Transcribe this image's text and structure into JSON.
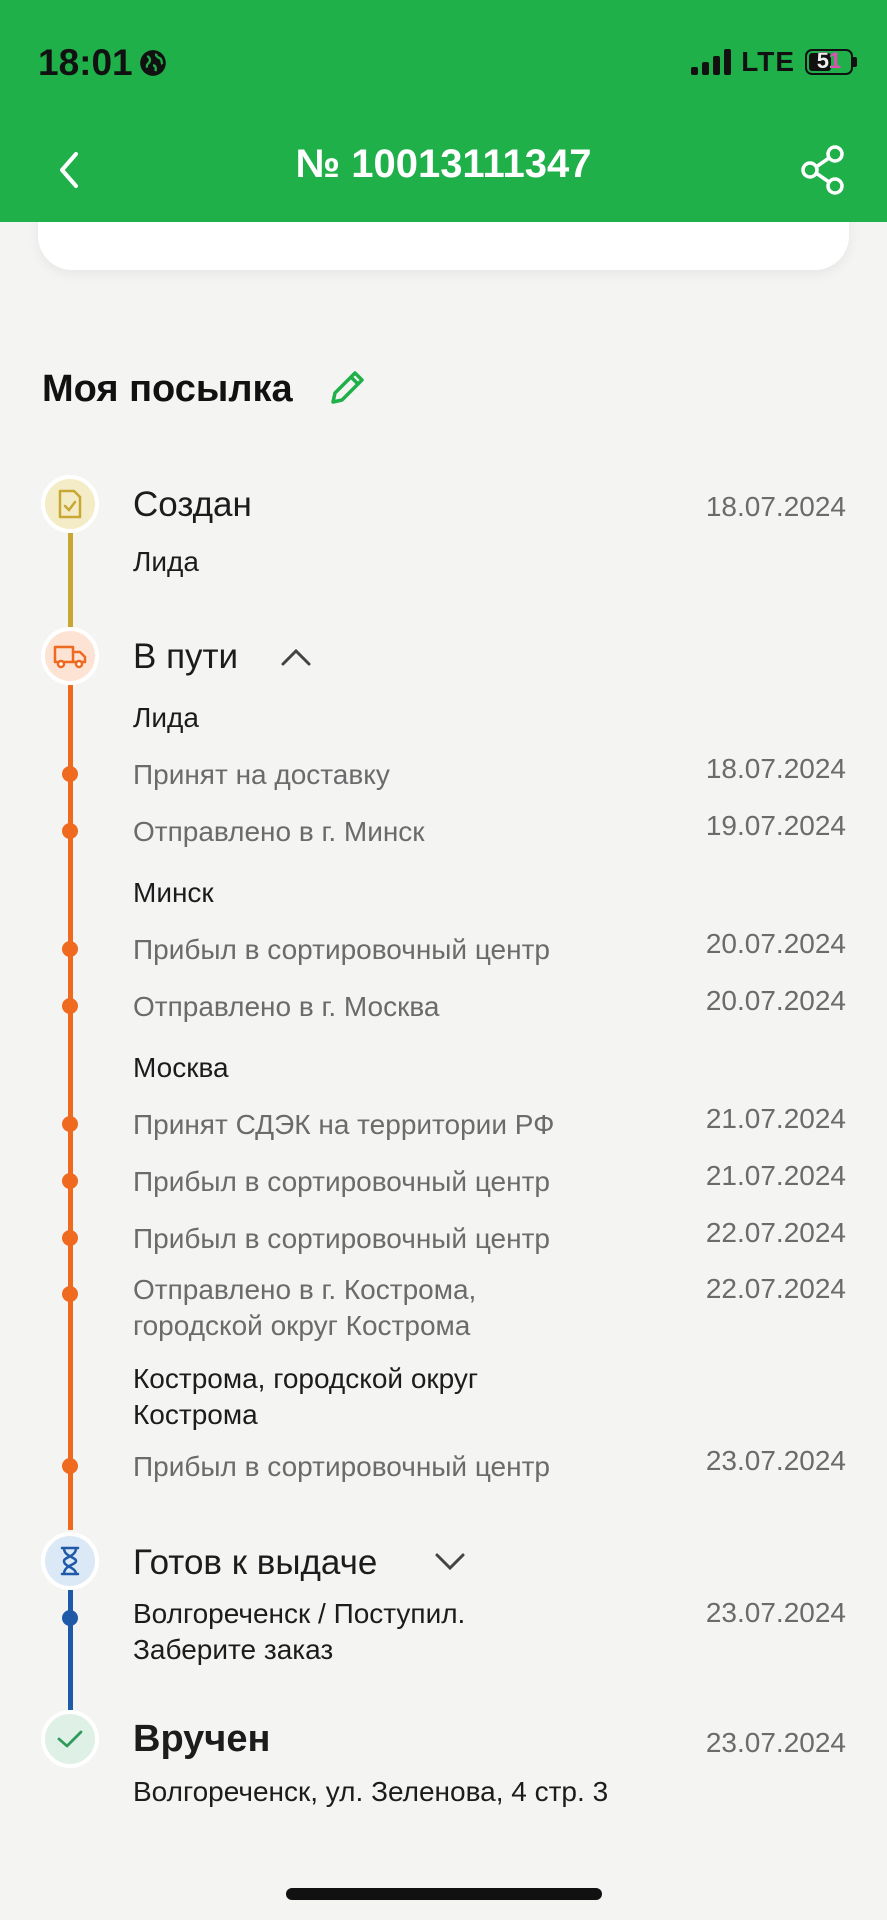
{
  "status_bar": {
    "time": "18:01",
    "network": "LTE",
    "battery": "51"
  },
  "header": {
    "title": "№ 10013111347"
  },
  "section": {
    "title": "Моя посылка"
  },
  "colors": {
    "brand_green": "#1fb04a",
    "created": "#c8a733",
    "transit": "#ef6a1f",
    "ready": "#1e5aa8",
    "delivered": "#2f9b5b"
  },
  "stages": {
    "created": {
      "name": "Создан",
      "date": "18.07.2024",
      "city": "Лида",
      "icon": "document-check-icon"
    },
    "transit": {
      "name": "В пути",
      "icon": "truck-icon",
      "cities": [
        "Лида",
        "Минск",
        "Москва",
        "Кострома, городской округ Кострома"
      ],
      "events": [
        {
          "label": "Принят на доставку",
          "date": "18.07.2024"
        },
        {
          "label": "Отправлено в г. Минск",
          "date": "19.07.2024"
        },
        {
          "label": "Прибыл в сортировочный центр",
          "date": "20.07.2024"
        },
        {
          "label": "Отправлено в г. Москва",
          "date": "20.07.2024"
        },
        {
          "label": "Принят СДЭК на территории РФ",
          "date": "21.07.2024"
        },
        {
          "label": "Прибыл в сортировочный центр",
          "date": "21.07.2024"
        },
        {
          "label": "Прибыл в сортировочный центр",
          "date": "22.07.2024"
        },
        {
          "label": "Отправлено в г. Кострома, городской округ Кострома",
          "date": "22.07.2024"
        },
        {
          "label": "Прибыл в сортировочный центр",
          "date": "23.07.2024"
        }
      ]
    },
    "ready": {
      "name": "Готов к выдаче",
      "icon": "hourglass-icon",
      "event": "Волгореченск / Поступил. Заберите заказ",
      "date": "23.07.2024"
    },
    "delivered": {
      "name": "Вручен",
      "icon": "check-icon",
      "address": "Волгореченск, ул. Зеленова, 4 стр. 3",
      "date": "23.07.2024"
    }
  }
}
